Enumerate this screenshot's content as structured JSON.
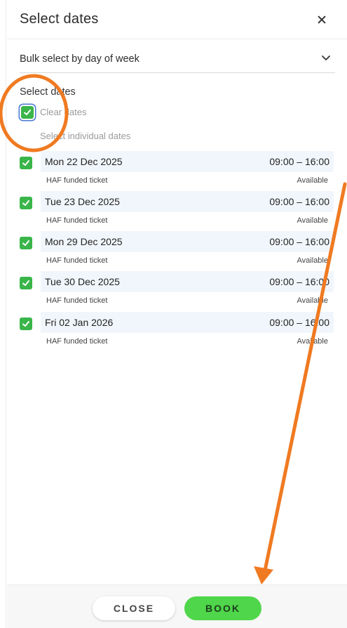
{
  "header": {
    "title": "Select dates"
  },
  "bulk_select": {
    "label": "Bulk select by day of week"
  },
  "section": {
    "title": "Select dates",
    "clear_label": "Clear dates",
    "individual_label": "Select individual dates"
  },
  "dates": [
    {
      "date": "Mon 22 Dec 2025",
      "time": "09:00 – 16:00",
      "ticket": "HAF funded ticket",
      "status": "Available",
      "checked": true
    },
    {
      "date": "Tue 23 Dec 2025",
      "time": "09:00 – 16:00",
      "ticket": "HAF funded ticket",
      "status": "Available",
      "checked": true
    },
    {
      "date": "Mon 29 Dec 2025",
      "time": "09:00 – 16:00",
      "ticket": "HAF funded ticket",
      "status": "Available",
      "checked": true
    },
    {
      "date": "Tue 30 Dec 2025",
      "time": "09:00 – 16:00",
      "ticket": "HAF funded ticket",
      "status": "Available",
      "checked": true
    },
    {
      "date": "Fri 02 Jan 2026",
      "time": "09:00 – 16:00",
      "ticket": "HAF funded ticket",
      "status": "Available",
      "checked": true
    }
  ],
  "footer": {
    "close_label": "CLOSE",
    "book_label": "BOOK"
  },
  "colors": {
    "checkbox": "#3ab54a",
    "book_button": "#4fd64a",
    "row_bg": "#f1f6fc",
    "annotation": "#f07a21"
  },
  "icons": {
    "close": "close-icon",
    "chevron": "chevron-down-icon",
    "check": "check-icon"
  }
}
